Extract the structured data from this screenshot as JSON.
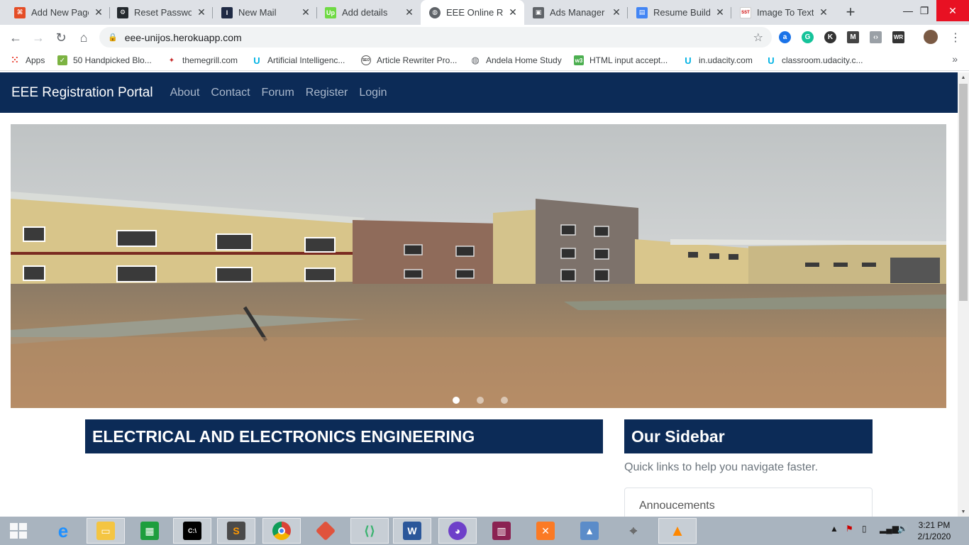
{
  "browser": {
    "tabs": [
      {
        "title": "Add New Page",
        "icon": "html5-icon",
        "color": "#e44d26",
        "glyph": "⌘"
      },
      {
        "title": "Reset Password",
        "icon": "github-icon",
        "color": "#24292e",
        "glyph": "⚙"
      },
      {
        "title": "New Mail",
        "icon": "mail-icon",
        "color": "#1f2a44",
        "glyph": "I"
      },
      {
        "title": "Add details",
        "icon": "upwork-icon",
        "color": "#6fda44",
        "glyph": "Up"
      },
      {
        "title": "EEE Online Reg",
        "icon": "globe-icon",
        "color": "#5f6368",
        "glyph": "◍"
      },
      {
        "title": "Ads Manager -",
        "icon": "ads-icon",
        "color": "#5f6368",
        "glyph": "▣"
      },
      {
        "title": "Resume Builder",
        "icon": "resume-icon",
        "color": "#4285f4",
        "glyph": "▤"
      },
      {
        "title": "Image To Text",
        "icon": "sst-icon",
        "color": "#ffffff",
        "glyph": "SST"
      }
    ],
    "active_tab": 4,
    "url": "eee-unijos.herokuapp.com",
    "bookmarks": [
      {
        "label": "Apps",
        "icon": "apps-grid-icon"
      },
      {
        "label": "50 Handpicked Blo...",
        "icon": "bookmark-green-icon"
      },
      {
        "label": "themegrill.com",
        "icon": "themegrill-icon"
      },
      {
        "label": "Artificial Intelligenc...",
        "icon": "udacity-icon"
      },
      {
        "label": "Article Rewriter Pro...",
        "icon": "seo-icon"
      },
      {
        "label": "Andela Home Study",
        "icon": "globe-icon"
      },
      {
        "label": "HTML input accept...",
        "icon": "w3-icon"
      },
      {
        "label": "in.udacity.com",
        "icon": "udacity-icon"
      },
      {
        "label": "classroom.udacity.c...",
        "icon": "udacity-icon"
      }
    ]
  },
  "site": {
    "brand": "EEE Registration Portal",
    "nav": [
      "About",
      "Contact",
      "Forum",
      "Register",
      "Login"
    ],
    "carousel": {
      "slides": 3,
      "active": 0
    },
    "main_heading": "ELECTRICAL AND ELECTRONICS ENGINEERING",
    "sidebar": {
      "title": "Our Sidebar",
      "subtitle": "Quick links to help you navigate faster.",
      "items": [
        "Annoucements"
      ]
    }
  },
  "taskbar": {
    "time": "3:21 PM",
    "date": "2/1/2020"
  },
  "colors": {
    "navbar": "#0c2b57",
    "heading_bg": "#0c2b57"
  }
}
